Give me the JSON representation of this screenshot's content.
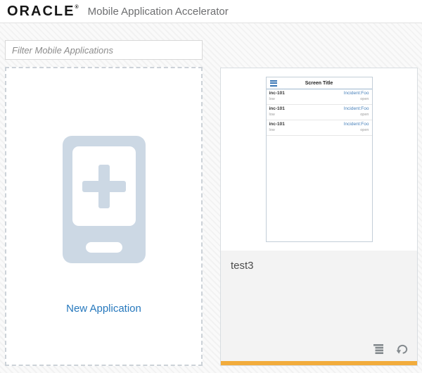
{
  "header": {
    "brand": "ORACLE",
    "registered_mark": "®",
    "app_title": "Mobile Application Accelerator"
  },
  "filter": {
    "placeholder": "Filter Mobile Applications"
  },
  "new_application_tile": {
    "label": "New Application",
    "icon": "phone-plus-icon"
  },
  "application_card": {
    "name": "test3",
    "status_bar_color": "#F2AC3C",
    "actions": [
      {
        "icon": "summary-list-icon"
      },
      {
        "icon": "return-arrow-icon"
      }
    ],
    "preview": {
      "menu_icon": "hamburger-icon",
      "screen_title": "Screen Title",
      "rows": [
        {
          "id": "inc-101",
          "sub": "low",
          "value": "Incident:Foo",
          "status": "open"
        },
        {
          "id": "inc-101",
          "sub": "low",
          "value": "Incident:Foo",
          "status": "open"
        },
        {
          "id": "inc-101",
          "sub": "low",
          "value": "Incident:Foo",
          "status": "open"
        }
      ]
    }
  },
  "colors": {
    "link_blue": "#2678BD",
    "preview_blue": "#3875B5",
    "icon_gray": "#848A8E",
    "phone_icon_fill": "#CCD8E4",
    "accent_bar": "#F2AC3C"
  }
}
